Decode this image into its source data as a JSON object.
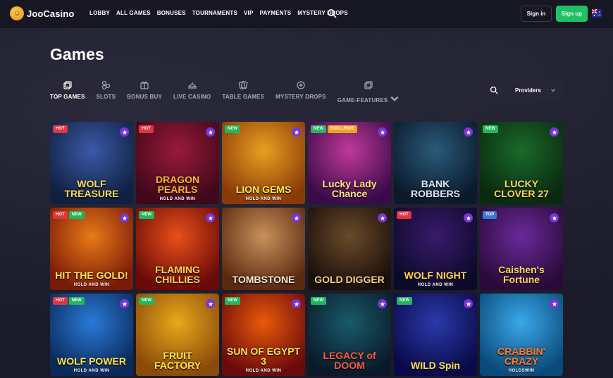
{
  "header": {
    "logo_text": "JooCasino",
    "nav": [
      "LOBBY",
      "ALL GAMES",
      "BONUSES",
      "TOURNAMENTS",
      "VIP",
      "PAYMENTS",
      "MYSTERY DROPS"
    ],
    "signin_label": "Sign in",
    "signup_label": "Sign up",
    "accent_color": "#20c063"
  },
  "page": {
    "title": "Games"
  },
  "categories": [
    {
      "label": "TOP GAMES",
      "icon": "top-games-icon",
      "active": true
    },
    {
      "label": "SLOTS",
      "icon": "slots-icon",
      "active": false
    },
    {
      "label": "BONUS BUY",
      "icon": "bonus-buy-icon",
      "active": false
    },
    {
      "label": "LIVE CASINO",
      "icon": "live-casino-icon",
      "active": false
    },
    {
      "label": "TABLE GAMES",
      "icon": "table-games-icon",
      "active": false
    },
    {
      "label": "MYSTERY DROPS",
      "icon": "mystery-drops-icon",
      "active": false
    },
    {
      "label": "GAME-FEATURES",
      "icon": "game-features-icon",
      "active": false
    }
  ],
  "providers_label": "Providers",
  "games": [
    {
      "title": "WOLF TREASURE",
      "sub": "",
      "badges": [
        "HOT"
      ],
      "bg": "#3a5aa8",
      "bg2": "#102040",
      "color": "#ffd84a"
    },
    {
      "title": "DRAGON PEARLS",
      "sub": "HOLD AND WIN",
      "badges": [
        "HOT"
      ],
      "bg": "#9a1a3a",
      "bg2": "#40081a",
      "color": "#ffb62a"
    },
    {
      "title": "LION GEMS",
      "sub": "HOLD AND WIN",
      "badges": [
        "NEW"
      ],
      "bg": "#e8a020",
      "bg2": "#8a3a08",
      "color": "#ffe34a"
    },
    {
      "title": "Lucky Lady Chance",
      "sub": "",
      "badges": [
        "NEW",
        "EXCLUSIVE"
      ],
      "bg": "#c03a9a",
      "bg2": "#3a0a4a",
      "color": "#ffe07a"
    },
    {
      "title": "BANK ROBBERS",
      "sub": "",
      "badges": [],
      "bg": "#2a5a7a",
      "bg2": "#0a1a2a",
      "color": "#dbe8f5"
    },
    {
      "title": "LUCKY CLOVER 27",
      "sub": "",
      "badges": [
        "NEW"
      ],
      "bg": "#1a6a2a",
      "bg2": "#0a2a10",
      "color": "#ffd84a"
    },
    {
      "title": "HIT THE GOLD!",
      "sub": "HOLD AND WIN",
      "badges": [
        "HOT",
        "NEW"
      ],
      "bg": "#e87a18",
      "bg2": "#7a1a08",
      "color": "#ffe04a"
    },
    {
      "title": "FLAMING CHILLIES",
      "sub": "",
      "badges": [
        "NEW"
      ],
      "bg": "#e8501a",
      "bg2": "#6a0a08",
      "color": "#ffd04a"
    },
    {
      "title": "TOMBSTONE",
      "sub": "",
      "badges": [],
      "bg": "#c8905a",
      "bg2": "#5a2a10",
      "color": "#f5e8d0"
    },
    {
      "title": "GOLD DIGGER",
      "sub": "",
      "badges": [],
      "bg": "#6a4a2a",
      "bg2": "#1a100a",
      "color": "#f5d07a"
    },
    {
      "title": "WOLF NIGHT",
      "sub": "HOLD AND WIN",
      "badges": [
        "HOT"
      ],
      "bg": "#3a1a6a",
      "bg2": "#0a0a2a",
      "color": "#ffd04a"
    },
    {
      "title": "Caishen's Fortune",
      "sub": "",
      "badges": [
        "TOP"
      ],
      "bg": "#6a2a9a",
      "bg2": "#2a0a3a",
      "color": "#ffd84a"
    },
    {
      "title": "WOLF POWER",
      "sub": "HOLD AND WIN",
      "badges": [
        "HOT",
        "NEW"
      ],
      "bg": "#2a7ad8",
      "bg2": "#0a2a5a",
      "color": "#ffe04a"
    },
    {
      "title": "FRUIT FACTORY",
      "sub": "",
      "badges": [
        "NEW"
      ],
      "bg": "#e8a81a",
      "bg2": "#8a4a0a",
      "color": "#ffe04a"
    },
    {
      "title": "SUN OF EGYPT 3",
      "sub": "HOLD AND WIN",
      "badges": [
        "NEW"
      ],
      "bg": "#e85a0a",
      "bg2": "#6a0a0a",
      "color": "#ffe04a"
    },
    {
      "title": "LEGACY of DOOM",
      "sub": "",
      "badges": [
        "NEW"
      ],
      "bg": "#1a5a6a",
      "bg2": "#0a1a2a",
      "color": "#ff5a3a"
    },
    {
      "title": "WILD Spin",
      "sub": "",
      "badges": [
        "NEW"
      ],
      "bg": "#2a3aa8",
      "bg2": "#0a0a4a",
      "color": "#ffe04a"
    },
    {
      "title": "CRABBIN' CRAZY",
      "sub": "HOLDSWIN",
      "badges": [],
      "bg": "#3aa8e8",
      "bg2": "#0a4a7a",
      "color": "#ff7a2a"
    }
  ]
}
